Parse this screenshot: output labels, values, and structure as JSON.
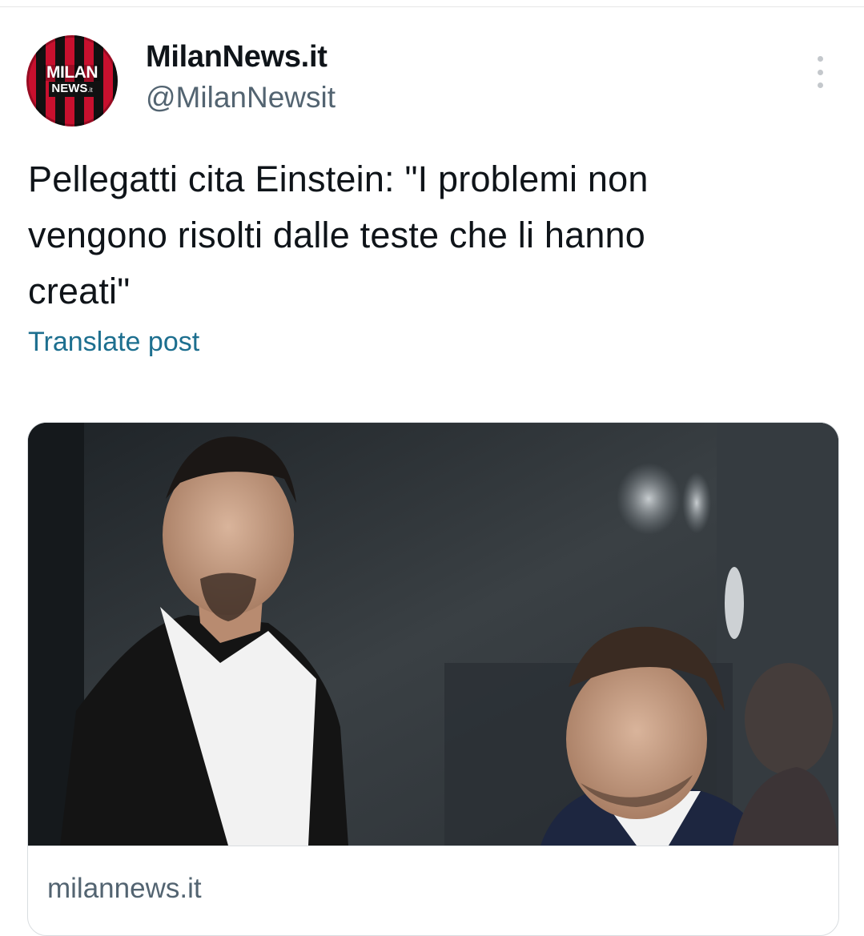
{
  "account": {
    "avatar_line1": "MILAN",
    "avatar_line2": "NEWS",
    "avatar_suffix": ".it",
    "display_name": "MilanNews.it",
    "handle": "@MilanNewsit"
  },
  "post": {
    "text": "Pellegatti cita Einstein: \"I problemi non\nvengono risolti dalle teste che li hanno\ncreati\"",
    "translate_label": "Translate post"
  },
  "link_card": {
    "image_icon": "photo-two-men-stadium",
    "domain": "milannews.it"
  },
  "icons": {
    "more": "more-vertical-icon"
  },
  "colors": {
    "link": "#1d6f8f",
    "secondary_text": "#536471",
    "milan_red": "#c8102e"
  }
}
